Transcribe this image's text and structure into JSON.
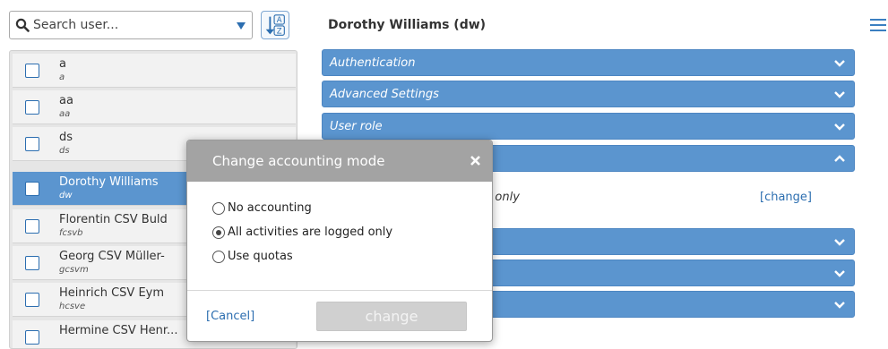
{
  "search": {
    "placeholder": "Search user..."
  },
  "users": [
    {
      "name": "a",
      "login": "a"
    },
    {
      "name": "aa",
      "login": "aa"
    },
    {
      "name": "ds",
      "login": "ds"
    },
    {
      "name": "Dorothy Williams",
      "login": "dw",
      "selected": true
    },
    {
      "name": "Florentin CSV Buld",
      "login": "fcsvb"
    },
    {
      "name": "Georg CSV Müller-",
      "login": "gcsvm"
    },
    {
      "name": "Heinrich CSV Eym",
      "login": "hcsve"
    },
    {
      "name": "Hermine CSV Henr...",
      "login": ""
    }
  ],
  "detail": {
    "title": "Dorothy Williams (dw)",
    "sections": [
      {
        "label": "Authentication",
        "state": "collapsed"
      },
      {
        "label": "Advanced Settings",
        "state": "collapsed"
      },
      {
        "label": "User role",
        "state": "collapsed"
      },
      {
        "label": "",
        "state": "expanded"
      },
      {
        "label": "",
        "state": "collapsed"
      },
      {
        "label": "",
        "state": "collapsed"
      },
      {
        "label": "",
        "state": "collapsed"
      }
    ],
    "accounting_value": "d only",
    "change_link": "[change]"
  },
  "modal": {
    "title": "Change accounting mode",
    "options": [
      {
        "label": "No accounting",
        "checked": false
      },
      {
        "label": "All activities are logged only",
        "checked": true
      },
      {
        "label": "Use quotas",
        "checked": false
      }
    ],
    "cancel_label": "[Cancel]",
    "change_label": "change"
  },
  "colors": {
    "accent": "#5b95cf",
    "link": "#2c6eb0",
    "modal_header": "#a3a3a3"
  },
  "icons": [
    "search-icon",
    "dropdown-icon",
    "sort-az-icon",
    "menu-icon",
    "chevron-down-icon",
    "chevron-up-icon",
    "close-icon"
  ]
}
